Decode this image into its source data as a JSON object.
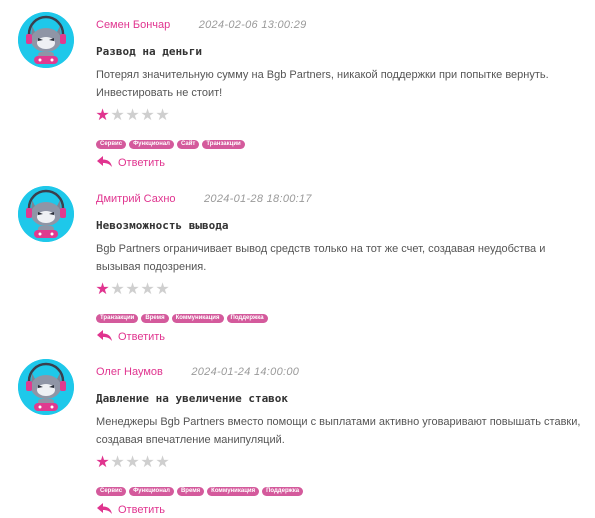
{
  "reviews": [
    {
      "author": "Семен Бончар",
      "date": "2024-02-06 13:00:29",
      "title": "Развод на деньги",
      "text": "Потерял значительную сумму на Bgb Partners, никакой поддержки при попытке вернуть. Инвестировать не стоит!",
      "rating": 1,
      "rating_max": 5,
      "tags": [
        "Сервис",
        "Функционал",
        "Сайт",
        "Транзакции"
      ],
      "reply_label": "Ответить"
    },
    {
      "author": "Дмитрий Сахно",
      "date": "2024-01-28 18:00:17",
      "title": "Невозможность вывода",
      "text": "Bgb Partners ограничивает вывод средств только на тот же счет, создавая неудобства и вызывая подозрения.",
      "rating": 1,
      "rating_max": 5,
      "tags": [
        "Транзакции",
        "Время",
        "Коммуникация",
        "Поддержка"
      ],
      "reply_label": "Ответить"
    },
    {
      "author": "Олег Наумов",
      "date": "2024-01-24 14:00:00",
      "title": "Давление на увеличение ставок",
      "text": "Менеджеры Bgb Partners вместо помощи с выплатами активно уговаривают повышать ставки, создавая впечатление манипуляций.",
      "rating": 1,
      "rating_max": 5,
      "tags": [
        "Сервис",
        "Функционал",
        "Время",
        "Коммуникация",
        "Поддержка"
      ],
      "reply_label": "Ответить"
    }
  ],
  "colors": {
    "accent": "#e0348f",
    "tag_bg": "#d45a9c",
    "avatar_bg": "#1ec8ea",
    "star_off": "#cfcfcf"
  },
  "icons": {
    "avatar": "cat-gamer-avatar-icon",
    "star": "star-icon",
    "reply": "reply-arrow-icon"
  }
}
